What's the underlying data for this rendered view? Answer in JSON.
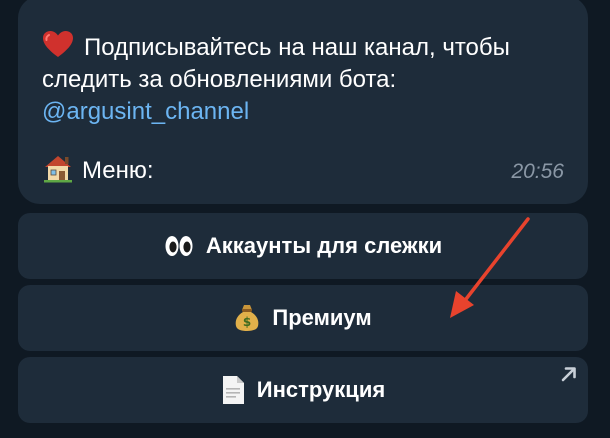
{
  "message": {
    "subscribe_text_line1": "Подписывайтесь на наш канал, чтобы",
    "subscribe_text_line2": "следить за обновлениями бота:",
    "channel_link": "@argusint_channel",
    "menu_label": "Меню:",
    "timestamp": "20:56"
  },
  "keyboard": {
    "buttons": [
      {
        "label": "Аккаунты для слежки",
        "icon": "eyes-icon"
      },
      {
        "label": "Премиум",
        "icon": "money-bag-icon"
      },
      {
        "label": "Инструкция",
        "icon": "document-icon",
        "has_external_link": true
      }
    ]
  },
  "colors": {
    "background": "#0f1923",
    "bubble": "#1e2c3a",
    "link": "#6cb5f2",
    "timestamp": "#8a97a5",
    "annotation_arrow": "#e8432d"
  }
}
